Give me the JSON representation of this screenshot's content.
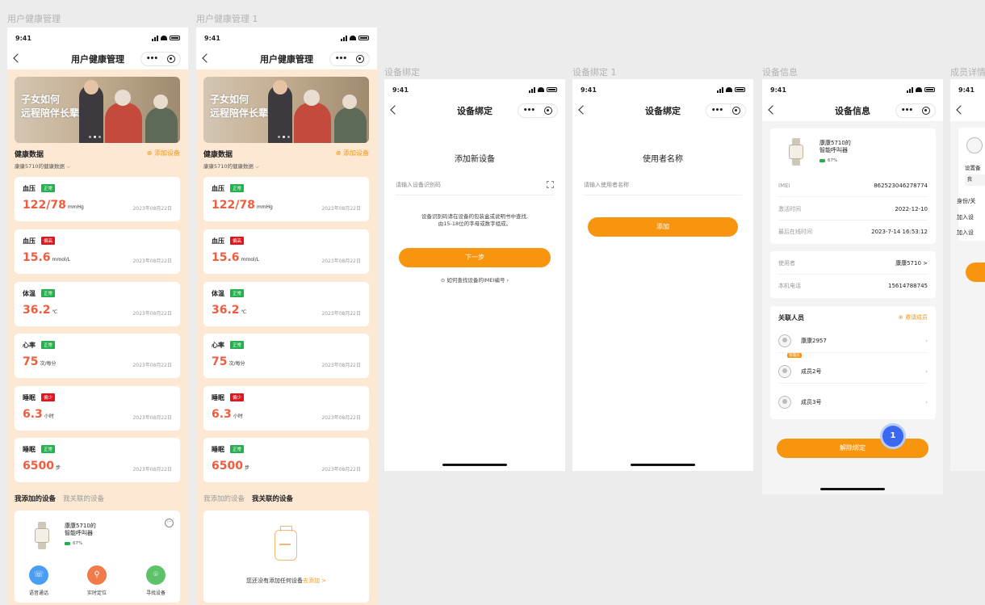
{
  "status_time": "9:41",
  "frame_labels": [
    "用户健康管理",
    "用户健康管理 1",
    "设备绑定",
    "设备绑定 1",
    "设备信息",
    "成员详情"
  ],
  "health": {
    "nav_title": "用户健康管理",
    "banner_line1": "子女如何",
    "banner_line2": "远程陪伴长辈",
    "section_title": "健康数据",
    "add_device": "添加设备",
    "sub_selector": "康康5710的健康数据",
    "metrics": [
      {
        "label": "血压",
        "tag": "正常",
        "status": "ok",
        "value": "122/78",
        "unit": "mmHg",
        "date": "2023年08月22日"
      },
      {
        "label": "血压",
        "tag": "偏高",
        "status": "bad",
        "value": "15.6",
        "unit": "mmol/L",
        "date": "2023年08月22日"
      },
      {
        "label": "体温",
        "tag": "正常",
        "status": "ok",
        "value": "36.2",
        "unit": "℃",
        "date": "2023年08月22日"
      },
      {
        "label": "心率",
        "tag": "正常",
        "status": "ok",
        "value": "75",
        "unit": "次/每分",
        "date": "2023年08月22日"
      },
      {
        "label": "睡眠",
        "tag": "偏少",
        "status": "bad",
        "value": "6.3",
        "unit": "小时",
        "date": "2023年08月22日"
      },
      {
        "label": "睡眠",
        "tag": "正常",
        "status": "ok",
        "value": "6500",
        "unit": "步",
        "date": "2023年08月22日"
      }
    ],
    "metrics_alt": [
      {
        "label": "血压",
        "tag": "正常",
        "status": "ok",
        "value": "122/78",
        "unit": "mmHg",
        "date": "2023年08月22日"
      },
      {
        "label": "血压",
        "tag": "偏高",
        "status": "bad",
        "value": "15.6",
        "unit": "mmol/L",
        "date": "2023年08月22日"
      },
      {
        "label": "体温",
        "tag": "正常",
        "status": "ok",
        "value": "36.2",
        "unit": "℃",
        "date": "2023年08月22日"
      },
      {
        "label": "心率",
        "tag": "正常",
        "status": "ok",
        "value": "75",
        "unit": "次/每分",
        "date": "2023年08月22日"
      },
      {
        "label": "睡眠",
        "tag": "偏少",
        "status": "bad",
        "value": "6.3",
        "unit": "小时",
        "date": "2023年08月22日"
      },
      {
        "label": "睡眠",
        "tag": "正常",
        "status": "ok",
        "value": "6500",
        "unit": "步",
        "date": "2023年08月22日"
      }
    ],
    "tab_mine": "我添加的设备",
    "tab_linked": "我关联的设备",
    "device_name_1": "康康5710的",
    "device_name_2": "智能呼叫器",
    "battery": "67%",
    "actions": [
      {
        "label": "语音通话",
        "color": "#4a9ef5",
        "icon": "phone-icon"
      },
      {
        "label": "实时定位",
        "color": "#f07c4a",
        "icon": "location-icon"
      },
      {
        "label": "寻找设备",
        "color": "#5ec26a",
        "icon": "find-icon"
      }
    ],
    "empty_text": "您还没有添加任何设备",
    "empty_link": "去添加 >"
  },
  "bind": {
    "nav_title": "设备绑定",
    "heading": "添加新设备",
    "input_placeholder": "请输入设备识别码",
    "hint_line1": "设备识别码请在设备的包装盒或说明书中查找,",
    "hint_line2": "由15-18位的字母或数字组成。",
    "next_button": "下一步",
    "help_link": "如何查找设备的IMEI编号"
  },
  "bind2": {
    "nav_title": "设备绑定",
    "heading": "使用者名称",
    "input_placeholder": "请输入使用者名称",
    "add_button": "添加"
  },
  "info": {
    "nav_title": "设备信息",
    "device_name_1": "康康5710的",
    "device_name_2": "智能呼叫器",
    "battery": "67%",
    "rows": [
      {
        "k": "IMEI",
        "v": "862523046278774"
      },
      {
        "k": "激活时间",
        "v": "2022-12-10"
      },
      {
        "k": "最后在线时间",
        "v": "2023-7-14 16:53:12"
      }
    ],
    "user_label": "使用者",
    "user_value": "康康5710 >",
    "phone_label": "本机电话",
    "phone_value": "15614788745",
    "members_title": "关联人员",
    "invite": "邀请成员",
    "members": [
      {
        "name": "康康2957",
        "badge": "管理员"
      },
      {
        "name": "成员2号",
        "badge": ""
      },
      {
        "name": "成员3号",
        "badge": ""
      }
    ],
    "unbind_button": "解除绑定",
    "pin_number": "1"
  },
  "member": {
    "setting_label": "设置备",
    "me": "我",
    "r1": "身份/关",
    "r2": "加入设",
    "r3": "加入设"
  }
}
